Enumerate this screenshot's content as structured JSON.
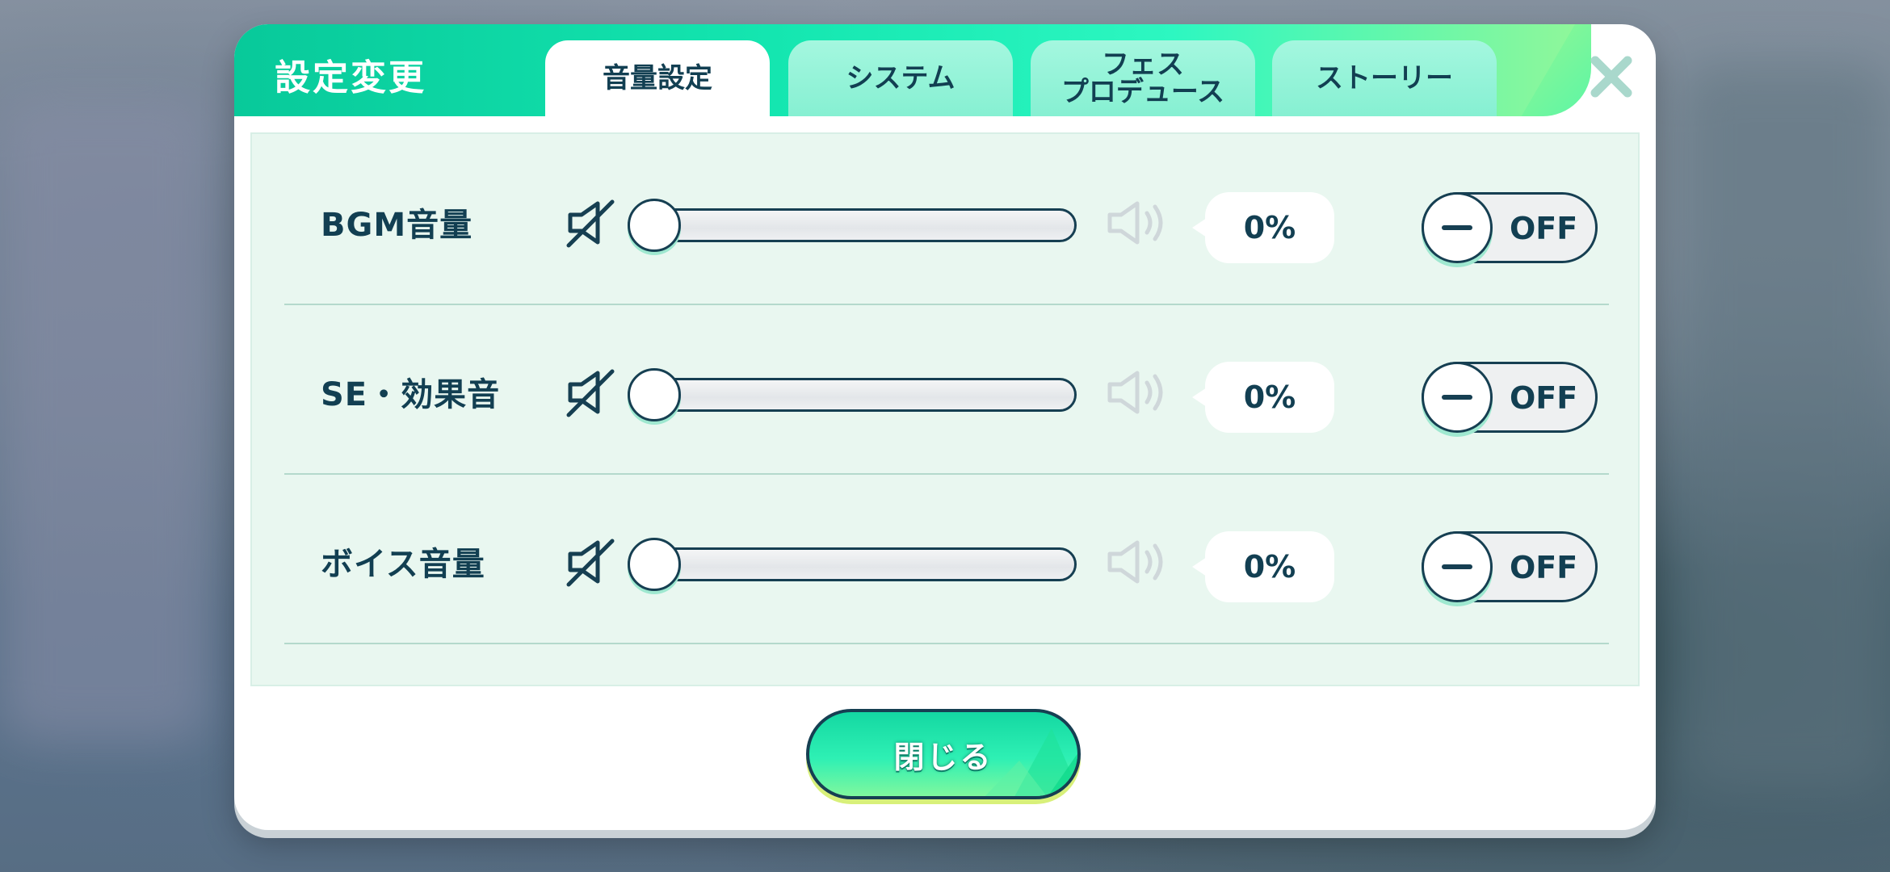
{
  "dialog": {
    "title": "設定変更",
    "tabs": [
      {
        "label": "音量設定",
        "active": true
      },
      {
        "label": "システム",
        "active": false
      },
      {
        "label_line1": "フェス",
        "label_line2": "プロデュース",
        "active": false
      },
      {
        "label": "ストーリー",
        "active": false
      }
    ],
    "close_icon": "close-x-icon"
  },
  "rows": [
    {
      "label": "BGM音量",
      "percent": "0%",
      "level": 0,
      "toggle": "OFF"
    },
    {
      "label": "SE・効果音",
      "percent": "0%",
      "level": 0,
      "toggle": "OFF"
    },
    {
      "label": "ボイス音量",
      "percent": "0%",
      "level": 0,
      "toggle": "OFF"
    }
  ],
  "footer": {
    "close_label": "閉じる"
  },
  "colors": {
    "accent": "#14e6b0",
    "accent_light": "#8ff79a",
    "text_dark": "#123f52",
    "panel_bg": "#e9f7f0"
  },
  "icons": {
    "mute": "speaker-muted-icon",
    "speaker": "speaker-volume-icon"
  }
}
